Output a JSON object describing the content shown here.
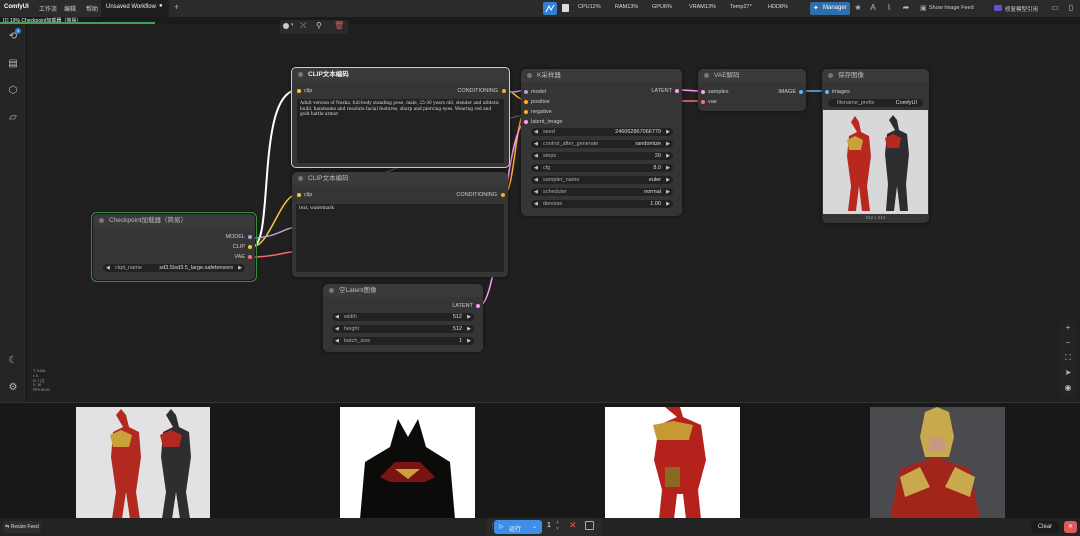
{
  "app": {
    "name": "ComfyUI"
  },
  "menu": {
    "workflow": "工作流",
    "edit": "编辑",
    "help": "帮助"
  },
  "tab": {
    "title": "Unsaved Workflow",
    "dirty_mark": "●",
    "add": "+"
  },
  "progress": {
    "label": "[1] 19%",
    "node": "Checkpoint加载器（简易）",
    "fraction": 0.19
  },
  "stats": {
    "cpu": "CPU12%",
    "ram": "RAM13%",
    "gpu": "GPU6%",
    "vram": "VRAM13%",
    "temp": "Temp27°",
    "hdd": "HDD8%"
  },
  "toolbar_right": {
    "manager": "Manager",
    "show_feed": "Show Image Feed",
    "model_ref": "修复模型引用"
  },
  "sidebar": {
    "queue_badge": "4"
  },
  "nodes": {
    "checkpoint": {
      "title": "Checkpoint加载器（简易）",
      "out_model": "MODEL",
      "out_clip": "CLIP",
      "out_vae": "VAE",
      "w_ckpt_label": "ckpt_name",
      "w_ckpt_value": "sd3.5/sd3.5_large.safetensors"
    },
    "clip_pos": {
      "title": "CLIP文本编码",
      "in_clip": "clip",
      "out_cond": "CONDITIONING",
      "text": "Adult version of Nezha, full-body standing pose, male, 25-30 years old, slender and athletic build, handsome and resolute facial features, sharp and piercing eyes. Wearing red and gold battle armor"
    },
    "clip_neg": {
      "title": "CLIP文本编码",
      "in_clip": "clip",
      "out_cond": "CONDITIONING",
      "text": "text, watermark"
    },
    "latent": {
      "title": "空Latent图像",
      "out": "LATENT",
      "w_width_label": "width",
      "w_width": "512",
      "w_height_label": "height",
      "w_height": "512",
      "w_batch_label": "batch_size",
      "w_batch": "1"
    },
    "ksampler": {
      "title": "K采样器",
      "in_model": "model",
      "in_pos": "positive",
      "in_neg": "negative",
      "in_latent": "latent_image",
      "out": "LATENT",
      "widgets": [
        {
          "label": "seed",
          "value": "246062867066779"
        },
        {
          "label": "control_after_generate",
          "value": "randomize"
        },
        {
          "label": "steps",
          "value": "20"
        },
        {
          "label": "cfg",
          "value": "8.0"
        },
        {
          "label": "sampler_name",
          "value": "euler"
        },
        {
          "label": "scheduler",
          "value": "normal"
        },
        {
          "label": "denoise",
          "value": "1.00"
        }
      ]
    },
    "vae": {
      "title": "VAE解码",
      "in_samples": "samples",
      "in_vae": "vae",
      "out": "IMAGE"
    },
    "save": {
      "title": "保存图像",
      "in_images": "images",
      "w_prefix_label": "filename_prefix",
      "w_prefix": "ComfyUI",
      "size": "512 x 512"
    }
  },
  "canvas_info": {
    "lines": [
      "T: 0.00s",
      "I: 0",
      "N: 7 [7]",
      "V: 16",
      "FPS:30.00"
    ]
  },
  "bottom": {
    "resize_feed": "⇆ Resize Feed",
    "run": "运行",
    "count": "1",
    "clear": "Clear"
  },
  "colors": {
    "accent": "#2f7fd6",
    "group_border": "#3fa34d",
    "clip_link": "#f3c940",
    "model_link": "#b39ddb",
    "vae_link": "#ff6e6e",
    "latent_link": "#ff9cf9",
    "image_link": "#64b5f6",
    "cond_link": "#ffa931"
  }
}
